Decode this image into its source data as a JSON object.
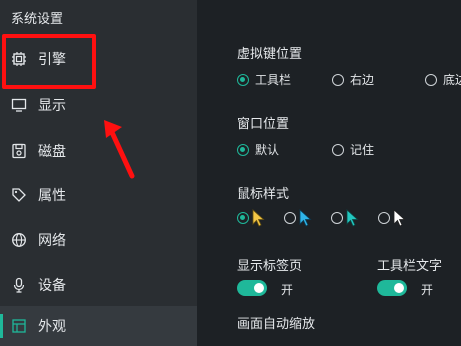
{
  "sidebar": {
    "title": "系统设置",
    "items": [
      {
        "label": "引擎",
        "icon": "chip-icon"
      },
      {
        "label": "显示",
        "icon": "monitor-icon"
      },
      {
        "label": "磁盘",
        "icon": "disk-icon"
      },
      {
        "label": "属性",
        "icon": "tag-icon"
      },
      {
        "label": "网络",
        "icon": "globe-icon"
      },
      {
        "label": "设备",
        "icon": "microphone-icon"
      },
      {
        "label": "外观",
        "icon": "appearance-icon"
      }
    ],
    "active_item": "外观"
  },
  "annotation": {
    "box_color": "#ff1010",
    "arrow_color": "#ff1010"
  },
  "main": {
    "virtual_key_position": {
      "title": "虚拟键位置",
      "options": [
        "工具栏",
        "右边",
        "底边"
      ],
      "selected": "工具栏"
    },
    "window_position": {
      "title": "窗口位置",
      "options": [
        "默认",
        "记住"
      ],
      "selected": "默认"
    },
    "mouse_style": {
      "title": "鼠标样式",
      "options": [
        "yellow-cursor-icon",
        "cyan-cursor-icon",
        "teal-cursor-icon",
        "white-cursor-icon"
      ],
      "selected_index": 0
    },
    "show_tabs": {
      "title": "显示标签页",
      "state": "开"
    },
    "toolbar_text": {
      "title": "工具栏文字",
      "state": "开"
    },
    "auto_zoom": {
      "title": "画面自动缩放"
    }
  },
  "colors": {
    "accent": "#1fb89a",
    "sidebar_bg": "#2a2e32",
    "main_bg": "#1d2125"
  }
}
